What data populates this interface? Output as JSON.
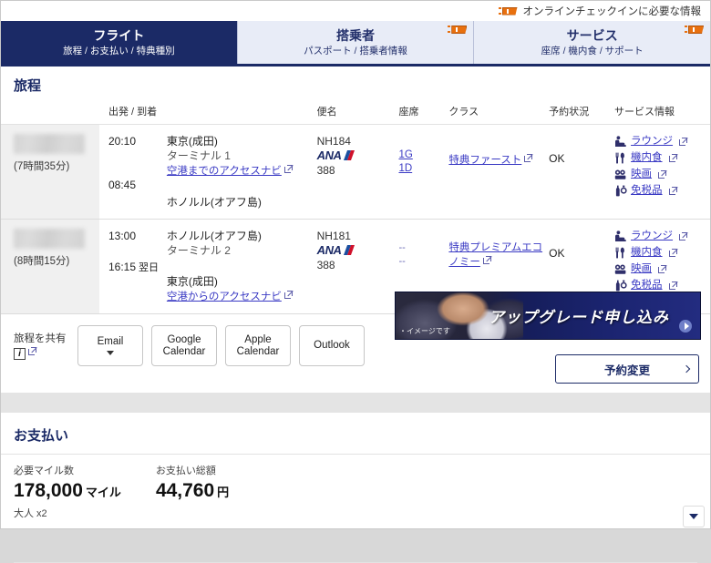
{
  "top_notice": {
    "icon": "ticket-icon",
    "label": "オンラインチェックインに必要な情報"
  },
  "tabs": [
    {
      "title": "フライト",
      "subtitle": "旅程 / お支払い / 特典種別",
      "active": true,
      "ticket": false
    },
    {
      "title": "搭乗者",
      "subtitle": "パスポート / 搭乗者情報",
      "active": false,
      "ticket": true
    },
    {
      "title": "サービス",
      "subtitle": "座席 / 機内食 / サポート",
      "active": false,
      "ticket": true
    }
  ],
  "itinerary": {
    "heading": "旅程",
    "columns": [
      "",
      "出発 / 到着",
      "",
      "便名",
      "座席",
      "クラス",
      "予約状況",
      "サービス情報"
    ],
    "rows": [
      {
        "duration": "(7時間35分)",
        "depart_time": "20:10",
        "arrive_time": "08:45",
        "arrive_next_day": "",
        "depart_place": "東京(成田)",
        "terminal": "ターミナル 1",
        "access_link": "空港までのアクセスナビ",
        "arrive_place": "ホノルル(オアフ島)",
        "arrive_terminal": "",
        "arrive_link": "",
        "flight_no": "NH184",
        "airline": "ANA",
        "aircraft": "388",
        "seats": [
          "1G",
          "1D"
        ],
        "seats_assigned": true,
        "class": "特典ファースト",
        "status": "OK",
        "services": [
          {
            "icon": "lounge-seat-icon",
            "label": "ラウンジ"
          },
          {
            "icon": "meal-icon",
            "label": "機内食"
          },
          {
            "icon": "movie-camera-icon",
            "label": "映画"
          },
          {
            "icon": "duty-free-icon",
            "label": "免税品"
          }
        ]
      },
      {
        "duration": "(8時間15分)",
        "depart_time": "13:00",
        "arrive_time": "16:15",
        "arrive_next_day": "翌日",
        "depart_place": "ホノルル(オアフ島)",
        "terminal": "ターミナル 2",
        "access_link": "",
        "arrive_place": "東京(成田)",
        "arrive_terminal": "",
        "arrive_link": "空港からのアクセスナビ",
        "flight_no": "NH181",
        "airline": "ANA",
        "aircraft": "388",
        "seats": [
          "--",
          "--"
        ],
        "seats_assigned": false,
        "class": "特典プレミアムエコノミー",
        "status": "OK",
        "services": [
          {
            "icon": "lounge-seat-icon",
            "label": "ラウンジ"
          },
          {
            "icon": "meal-icon",
            "label": "機内食"
          },
          {
            "icon": "movie-camera-icon",
            "label": "映画"
          },
          {
            "icon": "duty-free-icon",
            "label": "免税品"
          }
        ]
      }
    ]
  },
  "share": {
    "label": "旅程を共有",
    "info_icon": "info-icon",
    "buttons": [
      {
        "label": "Email",
        "dropdown": true
      },
      {
        "label_line1": "Google",
        "label_line2": "Calendar",
        "dropdown": false
      },
      {
        "label_line1": "Apple",
        "label_line2": "Calendar",
        "dropdown": false
      },
      {
        "label": "Outlook",
        "dropdown": false
      }
    ]
  },
  "banner": {
    "text": "アップグレード申し込み",
    "image_note": "・イメージです",
    "arrow": "play-arrow-icon"
  },
  "change_reservation": {
    "label": "予約変更",
    "chevron": "chevron-right-icon"
  },
  "payment": {
    "heading": "お支払い",
    "miles_label": "必要マイル数",
    "miles_value": "178,000",
    "miles_unit": "マイル",
    "passengers": "大人 x2",
    "total_label": "お支払い総額",
    "total_value": "44,760",
    "total_unit": "円",
    "toggle_icon": "chevron-down-icon"
  },
  "colors": {
    "brand_navy": "#1b2a66",
    "tab_inactive": "#e8ecf7",
    "link": "#3b3bc4",
    "ticket_orange": "#e8700f"
  }
}
